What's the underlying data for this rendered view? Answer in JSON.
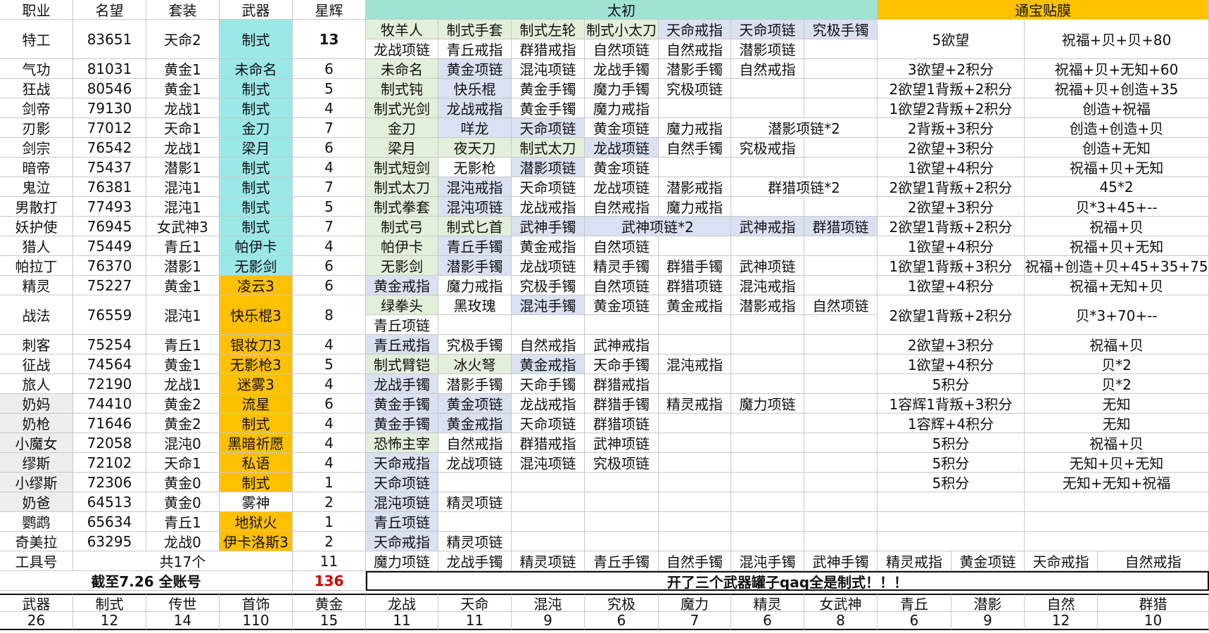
{
  "colors": {
    "cyan": "#9be8e8",
    "orange": "#ffc000",
    "lightgreen": "#e2efda",
    "lightblue": "#d9e1f2",
    "taichu_header": "#9fe3d3",
    "tongbao_header": "#ffc000",
    "grayjob": "#ededed",
    "red_text": "#d00000"
  },
  "headers": [
    "职业",
    "名望",
    "套装",
    "武器",
    "星辉"
  ],
  "taichu_title": "太初",
  "tongbao_title": "通宝贴膜",
  "rows": [
    {
      "job": "特工",
      "fame": "83651",
      "set": "天命2",
      "weapon": "制式",
      "wcolor": "cyan",
      "star": "13",
      "starbold": true,
      "taichu": [
        [
          "牧羊人",
          "制式手套",
          "制式左轮",
          "制式小太刀",
          "天命戒指",
          "天命项链",
          "究极手镯"
        ],
        [
          "龙战项链",
          "青丘戒指",
          "群猎戒指",
          "自然项链",
          "自然戒指",
          "潜影项链",
          ""
        ]
      ],
      "tongbao": [
        "5欲望",
        "祝福+贝+贝+80"
      ]
    },
    {
      "job": "气功",
      "fame": "81031",
      "set": "黄金1",
      "weapon": "未命名",
      "wcolor": "cyan",
      "star": "6",
      "taichu": [
        "未命名",
        "黄金项链",
        "混沌项链",
        "龙战手镯",
        "潜影手镯",
        "自然戒指",
        ""
      ],
      "tongbao": [
        "3欲望+2积分",
        "祝福+贝+无知+60"
      ]
    },
    {
      "job": "狂战",
      "fame": "80546",
      "set": "黄金1",
      "weapon": "制式",
      "wcolor": "cyan",
      "star": "5",
      "taichu": [
        "制式钝",
        "快乐棍",
        "黄金手镯",
        "魔力手镯",
        "究极项链",
        "",
        ""
      ],
      "tongbao": [
        "2欲望1背叛+2积分",
        "祝福+贝+创造+35"
      ]
    },
    {
      "job": "剑帝",
      "fame": "79130",
      "set": "龙战1",
      "weapon": "制式",
      "wcolor": "cyan",
      "star": "4",
      "taichu": [
        "制式光剑",
        "龙战戒指",
        "黄金手镯",
        "魔力戒指",
        "",
        "",
        ""
      ],
      "tongbao": [
        "1欲望2背叛+2积分",
        "创造+祝福"
      ]
    },
    {
      "job": "刃影",
      "fame": "77012",
      "set": "天命1",
      "weapon": "金刀",
      "wcolor": "cyan",
      "star": "7",
      "taichu": [
        "金刀",
        "咩龙",
        "天命项链",
        "黄金项链",
        "魔力戒指",
        "潜影项链*2",
        ""
      ],
      "tongbao": [
        "2背叛+3积分",
        "创造+创造+贝"
      ]
    },
    {
      "job": "剑宗",
      "fame": "76542",
      "set": "龙战1",
      "weapon": "梁月",
      "wcolor": "cyan",
      "star": "6",
      "taichu": [
        "梁月",
        "夜天刀",
        "制式太刀",
        "龙战项链",
        "自然手镯",
        "究极戒指",
        ""
      ],
      "tongbao": [
        "2欲望+3积分",
        "创造+无知"
      ]
    },
    {
      "job": "暗帝",
      "fame": "75437",
      "set": "潜影1",
      "weapon": "制式",
      "wcolor": "cyan",
      "star": "4",
      "taichu": [
        "制式短剑",
        "无影枪",
        "潜影项链",
        "黄金项链",
        "",
        "",
        ""
      ],
      "tongbao": [
        "1欲望+4积分",
        "祝福+贝+无知"
      ]
    },
    {
      "job": "鬼泣",
      "fame": "76381",
      "set": "混沌1",
      "weapon": "制式",
      "wcolor": "cyan",
      "star": "7",
      "taichu": [
        "制式太刀",
        "混沌戒指",
        "天命项链",
        "龙战项链",
        "潜影戒指",
        "群猎项链*2",
        ""
      ],
      "tongbao": [
        "2欲望1背叛+2积分",
        "45*2"
      ]
    },
    {
      "job": "男散打",
      "fame": "77493",
      "set": "混沌1",
      "weapon": "制式",
      "wcolor": "cyan",
      "star": "5",
      "taichu": [
        "制式拳套",
        "混沌项链",
        "龙战戒指",
        "自然戒指",
        "魔力戒指",
        "",
        ""
      ],
      "tongbao": [
        "2欲望+3积分",
        "贝*3+45+--"
      ]
    },
    {
      "job": "妖护使",
      "fame": "76945",
      "set": "女武神3",
      "weapon": "制式",
      "wcolor": "cyan",
      "star": "7",
      "taichu": [
        "制式弓",
        "制式匕首",
        "武神手镯",
        "武神项链*2",
        "",
        "武神戒指",
        "群猎项链"
      ],
      "tongbao": [
        "2欲望1背叛+2积分",
        "祝福+贝"
      ]
    },
    {
      "job": "猎人",
      "fame": "75449",
      "set": "青丘1",
      "weapon": "帕伊卡",
      "wcolor": "cyan",
      "star": "4",
      "taichu": [
        "帕伊卡",
        "青丘手镯",
        "黄金戒指",
        "自然项链",
        "",
        "",
        ""
      ],
      "tongbao": [
        "1欲望+4积分",
        "祝福+贝+无知"
      ]
    },
    {
      "job": "帕拉丁",
      "fame": "76370",
      "set": "潜影1",
      "weapon": "无影剑",
      "wcolor": "cyan",
      "star": "6",
      "taichu": [
        "无影剑",
        "潜影手镯",
        "龙战项链",
        "精灵手镯",
        "群猎手镯",
        "武神项链",
        ""
      ],
      "tongbao": [
        "1欲望1背叛+3积分",
        "祝福+创造+贝+45+35+75"
      ]
    },
    {
      "job": "精灵",
      "fame": "75227",
      "set": "黄金1",
      "weapon": "凌云3",
      "wcolor": "orange",
      "star": "6",
      "taichu": [
        "黄金戒指",
        "魔力戒指",
        "究极手镯",
        "自然项链",
        "群猎项链",
        "混沌戒指",
        ""
      ],
      "tongbao": [
        "1欲望+4积分",
        "祝福+无知+贝"
      ]
    },
    {
      "job": "战法",
      "fame": "76559",
      "set": "混沌1",
      "weapon": "快乐棍3",
      "wcolor": "orange",
      "star": "8",
      "taichu": [
        [
          "绿拳头",
          "黑玫瑰",
          "混沌手镯",
          "黄金项链",
          "黄金戒指",
          "潜影戒指",
          "自然项链"
        ],
        [
          "青丘项链",
          "",
          "",
          "",
          "",
          "",
          ""
        ]
      ],
      "tongbao": [
        "2欲望1背叛+2积分",
        "贝*3+70+--"
      ]
    },
    {
      "job": "刺客",
      "fame": "75254",
      "set": "青丘1",
      "weapon": "银妆刀3",
      "wcolor": "orange",
      "star": "4",
      "taichu": [
        "青丘戒指",
        "究极手镯",
        "自然戒指",
        "武神戒指",
        "",
        "",
        ""
      ],
      "tongbao": [
        "2欲望+3积分",
        "祝福+贝"
      ]
    },
    {
      "job": "征战",
      "fame": "74564",
      "set": "黄金1",
      "weapon": "无影枪3",
      "wcolor": "orange",
      "star": "5",
      "taichu": [
        "制式臂铠",
        "冰火弩",
        "黄金戒指",
        "天命手镯",
        "混沌戒指",
        "",
        ""
      ],
      "tongbao": [
        "1欲望+4积分",
        "贝*2"
      ]
    },
    {
      "job": "旅人",
      "fame": "72190",
      "set": "龙战1",
      "weapon": "迷雾3",
      "wcolor": "orange",
      "star": "4",
      "taichu": [
        "龙战手镯",
        "潜影手镯",
        "天命手镯",
        "群猎戒指",
        "",
        "",
        ""
      ],
      "tongbao": [
        "5积分",
        "贝*2"
      ]
    },
    {
      "job": "奶妈",
      "fame": "74410",
      "set": "黄金2",
      "weapon": "流星",
      "wcolor": "orange",
      "star": "6",
      "gray": true,
      "taichu": [
        "黄金手镯",
        "黄金项链",
        "龙战戒指",
        "群猎手镯",
        "精灵戒指",
        "魔力项链",
        ""
      ],
      "tongbao": [
        "1容辉1背叛+3积分",
        "无知"
      ]
    },
    {
      "job": "奶枪",
      "fame": "71646",
      "set": "黄金2",
      "weapon": "制式",
      "wcolor": "orange",
      "star": "4",
      "gray": true,
      "taichu": [
        "黄金手镯",
        "黄金戒指",
        "天命项链",
        "群猎项链",
        "",
        "",
        ""
      ],
      "tongbao": [
        "1容辉+4积分",
        "无知"
      ]
    },
    {
      "job": "小魔女",
      "fame": "72058",
      "set": "混沌0",
      "weapon": "黑暗祈愿",
      "wcolor": "orange",
      "star": "4",
      "gray": true,
      "taichu": [
        "恐怖主宰",
        "自然戒指",
        "群猎戒指",
        "武神项链",
        "",
        "",
        ""
      ],
      "tongbao": [
        "5积分",
        "祝福+贝"
      ]
    },
    {
      "job": "缪斯",
      "fame": "72102",
      "set": "天命1",
      "weapon": "私语",
      "wcolor": "orange",
      "star": "4",
      "gray": true,
      "taichu": [
        "天命戒指",
        "龙战项链",
        "混沌项链",
        "究极项链",
        "",
        "",
        ""
      ],
      "tongbao": [
        "5积分",
        "无知+贝+无知"
      ]
    },
    {
      "job": "小缪斯",
      "fame": "72306",
      "set": "黄金0",
      "weapon": "制式",
      "wcolor": "orange",
      "star": "1",
      "gray": true,
      "taichu": [
        "天命项链",
        "",
        "",
        "",
        "",
        "",
        ""
      ],
      "tongbao": [
        "5积分",
        "无知+无知+祝福"
      ]
    },
    {
      "job": "奶爸",
      "fame": "64513",
      "set": "黄金0",
      "weapon": "雾神",
      "wcolor": "white",
      "star": "2",
      "gray": true,
      "taichu": [
        "混沌项链",
        "精灵项链",
        "",
        "",
        "",
        "",
        ""
      ],
      "tongbao": [
        "",
        ""
      ]
    },
    {
      "job": "鹦鹉",
      "fame": "65634",
      "set": "青丘1",
      "weapon": "地狱火",
      "wcolor": "orange",
      "star": "1",
      "taichu": [
        "青丘项链",
        "",
        "",
        "",
        "",
        "",
        ""
      ],
      "tongbao": [
        "",
        ""
      ]
    },
    {
      "job": "奇美拉",
      "fame": "63295",
      "set": "龙战0",
      "weapon": "伊卡洛斯3",
      "wcolor": "orange",
      "star": "2",
      "taichu": [
        "天命戒指",
        "精灵项链",
        "",
        "",
        "",
        "",
        ""
      ],
      "tongbao": [
        "",
        ""
      ]
    }
  ],
  "tool_row": {
    "label": "工具号",
    "count": "共17个",
    "star": "11",
    "items": [
      "魔力项链",
      "龙战手镯",
      "精灵项链",
      "青丘手镯",
      "自然手镯",
      "混沌手镯",
      "武神手镯",
      "精灵戒指",
      "黄金项链",
      "天命戒指",
      "自然戒指"
    ]
  },
  "total_row": {
    "label": "截至7.26 全账号",
    "star": "136",
    "note": "开了三个武器罐子qaq全是制式！！！"
  },
  "summary": {
    "labels": [
      "武器",
      "制式",
      "传世",
      "首饰",
      "黄金",
      "龙战",
      "天命",
      "混沌",
      "究极",
      "魔力",
      "精灵",
      "女武神",
      "青丘",
      "潜影",
      "自然",
      "群猎"
    ],
    "values": [
      "26",
      "12",
      "14",
      "110",
      "15",
      "11",
      "11",
      "9",
      "6",
      "7",
      "6",
      "8",
      "6",
      "9",
      "12",
      "10"
    ]
  }
}
